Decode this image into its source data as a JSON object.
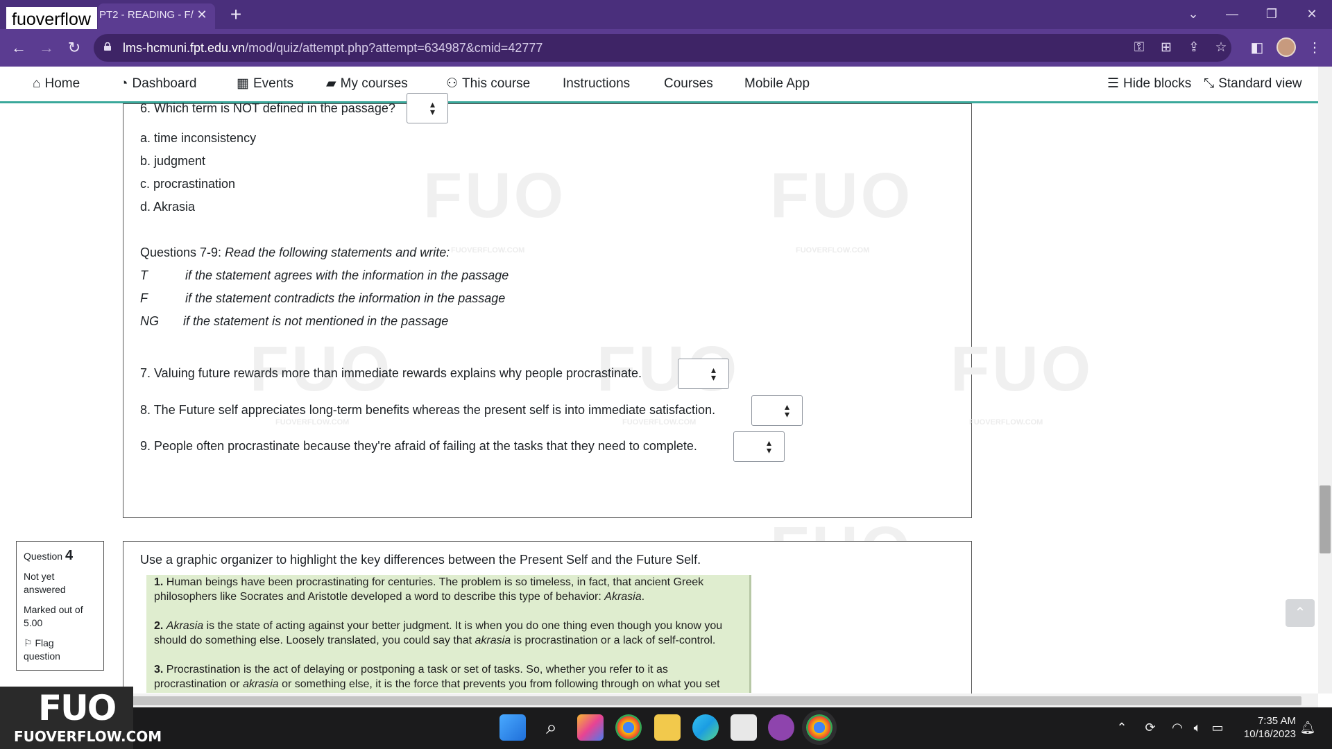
{
  "browser": {
    "tab_title": "PT2 - READING - F/",
    "tab_close": "✕",
    "new_tab": "+",
    "overlay_logo": "fuoverflow",
    "url_host": "lms-hcmuni.fpt.edu.vn",
    "url_path": "/mod/quiz/attempt.php?attempt=634987&cmid=42777"
  },
  "nav": {
    "home": "Home",
    "dashboard": "Dashboard",
    "events": "Events",
    "my_courses": "My courses",
    "this_course": "This course",
    "instructions": "Instructions",
    "courses": "Courses",
    "mobile_app": "Mobile App",
    "hide_blocks": "Hide blocks",
    "standard_view": "Standard view"
  },
  "q3": {
    "q6": "6. Which term is NOT defined in the passage?",
    "options": [
      "a. time inconsistency",
      "b. judgment",
      "c. procrastination",
      "d. Akrasia"
    ],
    "instr_prefix": "Questions 7-9: ",
    "instr_rest": "Read the following statements and write:",
    "legend": [
      {
        "code": "T",
        "text": "if the statement agrees with the information in the passage"
      },
      {
        "code": "F",
        "text": "if the statement contradicts the information in the passage"
      },
      {
        "code": "NG",
        "text": "if the statement is not mentioned in the passage"
      }
    ],
    "q7": "7. Valuing future rewards more than immediate rewards explains why people procrastinate.",
    "q8": "8. The Future self appreciates long-term benefits whereas the present self is into immediate satisfaction.",
    "q9": "9. People often procrastinate because they're afraid of failing at the tasks that they need to complete."
  },
  "q4info": {
    "label": "Question",
    "number": "4",
    "status_1": "Not yet",
    "status_2": "answered",
    "marked_1": "Marked out of",
    "marked_2": "5.00",
    "flag_1": "Flag",
    "flag_2": "question"
  },
  "q4": {
    "prompt": "Use a graphic organizer to highlight the key differences between the Present Self and the Future Self.",
    "p1_num": "1.",
    "p1_l1": "Human beings have been procrastinating for centuries. The problem is so timeless, in fact, that ancient Greek",
    "p1_l2": "philosophers like Socrates and Aristotle developed a word to describe this type of behavior: ",
    "p1_l2_it": "Akrasia",
    "p1_l2_end": ".",
    "p2_num": "2.",
    "p2_l1_it": "Akrasia",
    "p2_l1": " is the state of acting against your better judgment. It is when you do one thing even though you know you",
    "p2_l2": "should do something else. Loosely translated, you could say that ",
    "p2_l2_it": "akrasia",
    "p2_l2_end": " is procrastination or a lack of self-control.",
    "p3_num": "3.",
    "p3_l1": "Procrastination is the act of delaying or postponing a task or set of tasks. So, whether you refer to it as",
    "p3_l2": "procrastination or ",
    "p3_l2_it": "akrasia",
    "p3_l2_end": " or something else, it is the force that prevents you from following through on what you set"
  },
  "watermark": {
    "text": "FUO",
    "small": "FUOVERFLOW.COM"
  },
  "overlay": {
    "fuo": "FUO",
    "site": "FUOVERFLOW.COM"
  },
  "taskbar": {
    "time": "7:35 AM",
    "date": "10/16/2023"
  },
  "colors": {
    "tabbar": "#4a2f7c",
    "addressbar": "#5b3c91",
    "navbar_border": "#3aa89b",
    "passage_bg": "#dfedcf"
  }
}
